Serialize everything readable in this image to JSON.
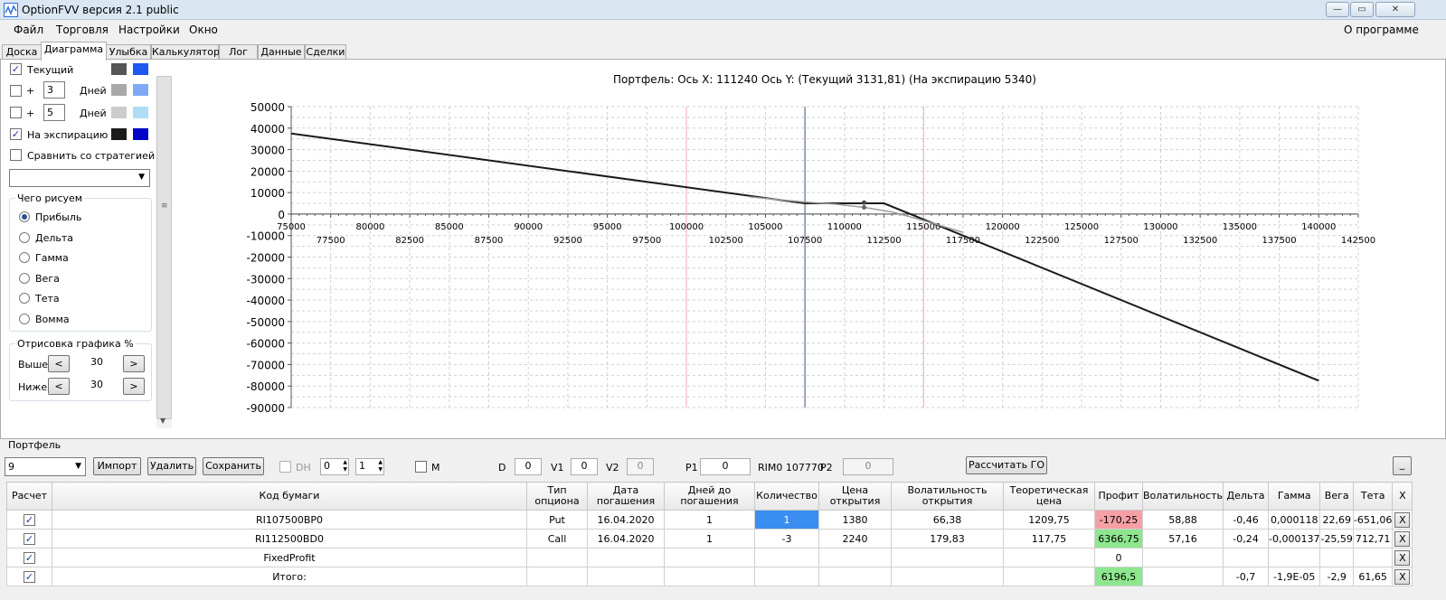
{
  "window": {
    "title": "OptionFVV версия 2.1 public",
    "min": "—",
    "max": "▭",
    "close": "✕"
  },
  "menu": {
    "items": [
      "Файл",
      "Торговля",
      "Настройки",
      "Окно"
    ],
    "about": "О программе"
  },
  "tabs": [
    "Доска",
    "Диаграмма",
    "Улыбка",
    "Калькулятор",
    "Лог",
    "Данные",
    "Сделки"
  ],
  "left_panel": {
    "current": {
      "label": "Текущий",
      "checked": true,
      "colors": [
        "#555555",
        "#1f57f2"
      ]
    },
    "plus1": {
      "plus": "+",
      "days": "3",
      "unit": "Дней",
      "checked": false,
      "colors": [
        "#a9a9a9",
        "#7fa8f6"
      ]
    },
    "plus2": {
      "plus": "+",
      "days": "5",
      "unit": "Дней",
      "checked": false,
      "colors": [
        "#cccccc",
        "#b0dcf6"
      ]
    },
    "expiry": {
      "label": "На экспирацию",
      "checked": true,
      "colors": [
        "#1b1b1b",
        "#0000c8"
      ]
    },
    "compare": {
      "label": "Сравнить со стратегией",
      "checked": false
    },
    "draw_group": {
      "title": "Чего рисуем",
      "options": [
        "Прибыль",
        "Дельта",
        "Гамма",
        "Вега",
        "Тета",
        "Вомма"
      ],
      "selected": 0
    },
    "render_group": {
      "title": "Отрисовка графика %",
      "above_label": "Выше",
      "below_label": "Ниже",
      "above": "30",
      "below": "30",
      "dec": "<",
      "inc": ">"
    }
  },
  "chart_data": {
    "type": "line",
    "title": "Портфель:  Ось X:  111240  Ось Y:   (Текущий 3131,81)   (На экспирацию 5340)",
    "xlim": [
      75000,
      142500
    ],
    "ylim": [
      -90000,
      50000
    ],
    "x_ticks_upper": [
      "75000",
      "80000",
      "85000",
      "90000",
      "95000",
      "100000",
      "105000",
      "110000",
      "115000",
      "120000",
      "125000",
      "130000",
      "135000",
      "140000"
    ],
    "x_ticks_lower": [
      "77500",
      "82500",
      "87500",
      "92500",
      "97500",
      "102500",
      "107500",
      "112500",
      "117500",
      "122500",
      "127500",
      "132500",
      "137500",
      "142500"
    ],
    "y_ticks": [
      "50000",
      "40000",
      "30000",
      "20000",
      "10000",
      "0",
      "-10000",
      "-20000",
      "-30000",
      "-40000",
      "-50000",
      "-60000",
      "-70000",
      "-80000",
      "-90000"
    ],
    "vertical_lines": [
      {
        "x": 100000,
        "color": "#f4a5b5"
      },
      {
        "x": 107500,
        "color": "#7a8aa6"
      },
      {
        "x": 115000,
        "color": "#f4a5b5"
      }
    ],
    "series": [
      {
        "color": "#1a1a1a",
        "x": [
          75000,
          107500,
          112500,
          140000
        ],
        "y": [
          37500,
          5000,
          5000,
          -77500
        ]
      },
      {
        "color": "#9a9a9a",
        "x": [
          104000,
          107500,
          109500,
          111240,
          113000,
          115000,
          117500
        ],
        "y": [
          8000,
          5600,
          4600,
          3130,
          1000,
          -3000,
          -8500
        ]
      }
    ],
    "markers": [
      {
        "x": 111240,
        "y": 5340,
        "color": "#444444"
      },
      {
        "x": 111240,
        "y": 3130,
        "color": "#666666"
      }
    ]
  },
  "portfolio": {
    "label": "Портфель",
    "combo": "9",
    "btn_import": "Импорт",
    "btn_delete": "Удалить",
    "btn_save": "Сохранить",
    "dh": "DH",
    "dh_a": "0",
    "dh_b": "1",
    "m": "M",
    "d_label": "D",
    "d": "0",
    "v1_label": "V1",
    "v1": "0",
    "v2_label": "V2",
    "v2": "0",
    "p1_label": "P1",
    "p1": "0",
    "rim": "RIM0 107770",
    "p2_label": "P2",
    "p2": "0",
    "btn_go": "Рассчитать ГО",
    "btn_min": "_"
  },
  "table": {
    "headers": [
      "Расчет",
      "Код бумаги",
      "Тип опциона",
      "Дата погашения",
      "Дней до погашения",
      "Количество",
      "Цена открытия",
      "Волатильность открытия",
      "Теоретическая цена",
      "Профит",
      "Волатильность",
      "Дельта",
      "Гамма",
      "Вега",
      "Тета",
      "X"
    ],
    "rows": [
      [
        "RI107500BP0",
        "Put",
        "16.04.2020",
        "1",
        "1",
        "1380",
        "66,38",
        "1209,75",
        "-170,25",
        "58,88",
        "-0,46",
        "0,000118",
        "22,69",
        "-651,06"
      ],
      [
        "RI112500BD0",
        "Call",
        "16.04.2020",
        "1",
        "-3",
        "2240",
        "179,83",
        "117,75",
        "6366,75",
        "57,16",
        "-0,24",
        "-0,000137",
        "-25,59",
        "712,71"
      ],
      [
        "FixedProfit",
        "",
        "",
        "",
        "",
        "",
        "",
        "",
        "0",
        "",
        "",
        "",
        "",
        ""
      ],
      [
        "Итого:",
        "",
        "",
        "",
        "",
        "",
        "",
        "",
        "6196,5",
        "",
        "-0,7",
        "-1,9E-05",
        "-2,9",
        "61,65"
      ]
    ],
    "profit_colors": [
      "#f6a0a6",
      "#8ee68e",
      "#ffffff",
      "#8ee68e"
    ],
    "x_label": "X",
    "check": "✓"
  }
}
